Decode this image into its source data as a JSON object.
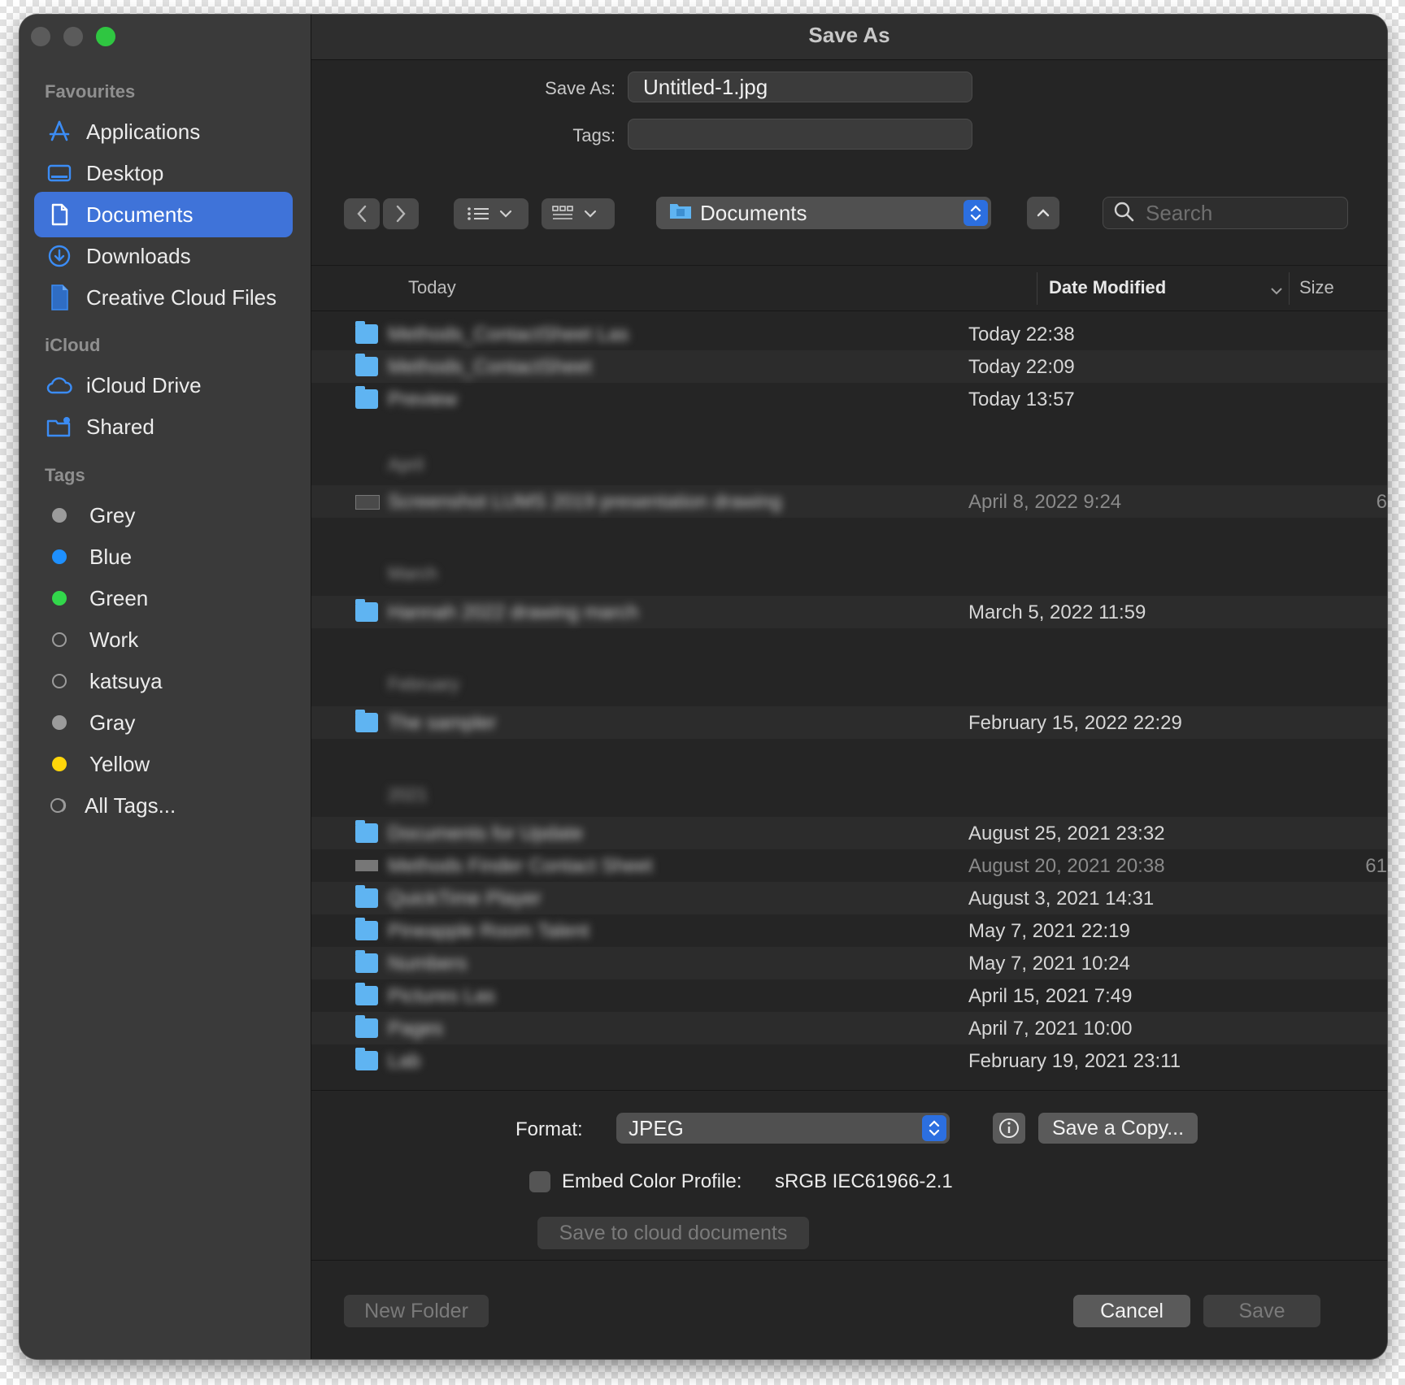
{
  "window": {
    "title": "Save As"
  },
  "sidebar": {
    "favourites_header": "Favourites",
    "favourites": [
      {
        "label": "Applications",
        "icon": "applications-icon"
      },
      {
        "label": "Desktop",
        "icon": "desktop-icon"
      },
      {
        "label": "Documents",
        "icon": "document-icon",
        "selected": true
      },
      {
        "label": "Downloads",
        "icon": "downloads-icon"
      },
      {
        "label": "Creative Cloud Files",
        "icon": "file-icon"
      }
    ],
    "icloud_header": "iCloud",
    "icloud": [
      {
        "label": "iCloud Drive",
        "icon": "cloud-icon"
      },
      {
        "label": "Shared",
        "icon": "shared-folder-icon"
      }
    ],
    "tags_header": "Tags",
    "tags": [
      {
        "label": "Grey",
        "color": "#9b9b9b",
        "style": "filled"
      },
      {
        "label": "Blue",
        "color": "#1e90ff",
        "style": "filled"
      },
      {
        "label": "Green",
        "color": "#32d74b",
        "style": "filled"
      },
      {
        "label": "Work",
        "color": "#9b9b9b",
        "style": "outline"
      },
      {
        "label": "katsuya",
        "color": "#9b9b9b",
        "style": "outline"
      },
      {
        "label": "Gray",
        "color": "#9b9b9b",
        "style": "filled"
      },
      {
        "label": "Yellow",
        "color": "#ffd60a",
        "style": "filled"
      },
      {
        "label": "All Tags...",
        "color": "#9b9b9b",
        "style": "all"
      }
    ]
  },
  "form": {
    "save_as_label": "Save As:",
    "save_as_value": "Untitled-1.jpg",
    "tags_label": "Tags:",
    "tags_value": ""
  },
  "toolbar": {
    "location": "Documents",
    "search_placeholder": "Search"
  },
  "list": {
    "columns": {
      "group": "Today",
      "date": "Date Modified",
      "size": "Size"
    },
    "group_today": "Today",
    "group_april": "April",
    "group_march": "March",
    "group_february": "February",
    "group_2021": "2021",
    "rows": [
      {
        "name": "Methods_ContactSheet Las",
        "date": "Today 22:38",
        "size": ""
      },
      {
        "name": "Methods_ContactSheet",
        "date": "Today 22:09",
        "size": ""
      },
      {
        "name": "Preview",
        "date": "Today 13:57",
        "size": ""
      },
      {
        "name": "Screenshot LUMS 2019 presentation drawing",
        "date": "April 8, 2022 9:24",
        "size": "6"
      },
      {
        "name": "Hannah 2022 drawing march",
        "date": "March 5, 2022 11:59",
        "size": ""
      },
      {
        "name": "The sampler",
        "date": "February 15, 2022 22:29",
        "size": ""
      },
      {
        "name": "Documents for Update",
        "date": "August 25, 2021 23:32",
        "size": ""
      },
      {
        "name": "Methods Finder Contact Sheet",
        "date": "August 20, 2021 20:38",
        "size": "61"
      },
      {
        "name": "QuickTime Player",
        "date": "August 3, 2021 14:31",
        "size": ""
      },
      {
        "name": "Pineapple Room Talent",
        "date": "May 7, 2021 22:19",
        "size": ""
      },
      {
        "name": "Numbers",
        "date": "May 7, 2021 10:24",
        "size": ""
      },
      {
        "name": "Pictures Las",
        "date": "April 15, 2021 7:49",
        "size": ""
      },
      {
        "name": "Pages",
        "date": "April 7, 2021 10:00",
        "size": ""
      },
      {
        "name": "Lab",
        "date": "February 19, 2021 23:11",
        "size": ""
      }
    ]
  },
  "options": {
    "format_label": "Format:",
    "format_value": "JPEG",
    "save_copy_label": "Save a Copy...",
    "embed_label": "Embed Color Profile:",
    "embed_value": "sRGB IEC61966-2.1",
    "cloud_button": "Save to cloud documents"
  },
  "footer": {
    "new_folder": "New Folder",
    "cancel": "Cancel",
    "save": "Save"
  },
  "colors": {
    "accent": "#3f73d9",
    "stepper": "#2c6fe0",
    "folder": "#5fb4f2"
  }
}
